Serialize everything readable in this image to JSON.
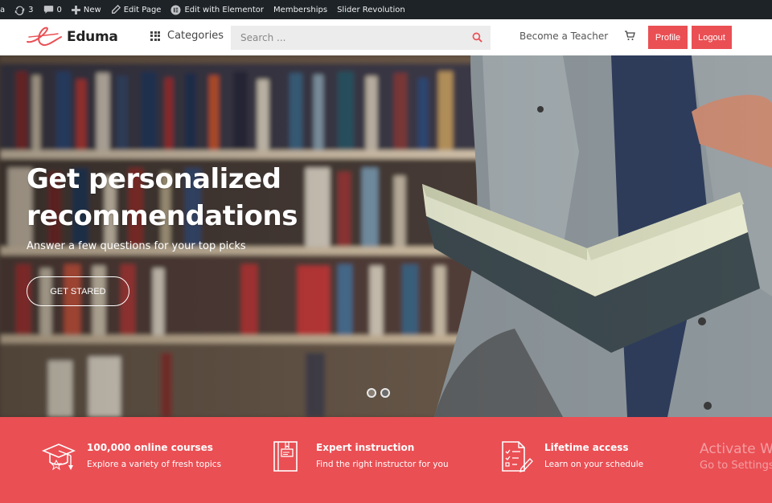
{
  "admin_bar": {
    "site_fragment": "a",
    "updates_count": "3",
    "comments_count": "0",
    "new_label": "New",
    "edit_page_label": "Edit Page",
    "elementor_label": "Edit with Elementor",
    "memberships_label": "Memberships",
    "slider_label": "Slider Revolution"
  },
  "header": {
    "logo_text": "Eduma",
    "categories_label": "Categories",
    "search_placeholder": "Search ...",
    "become_teacher_label": "Become a Teacher",
    "profile_label": "Profile",
    "logout_label": "Logout"
  },
  "hero": {
    "title_line1": "Get personalized",
    "title_line2": "recommendations",
    "subtitle": "Answer a few questions for your top picks",
    "cta_label": "GET STARED",
    "slides": 2,
    "active_slide": 2
  },
  "features": [
    {
      "icon": "graduation-cap-icon",
      "title": "100,000 online courses",
      "desc": "Explore a variety of fresh topics"
    },
    {
      "icon": "book-icon",
      "title": "Expert instruction",
      "desc": "Find the right instructor for you"
    },
    {
      "icon": "checklist-icon",
      "title": "Lifetime access",
      "desc": "Learn on your schedule"
    }
  ],
  "watermark": {
    "line1": "Activate W",
    "line2": "Go to Settings"
  },
  "colors": {
    "accent": "#ea4f54",
    "admin_bar": "#1d2327"
  }
}
